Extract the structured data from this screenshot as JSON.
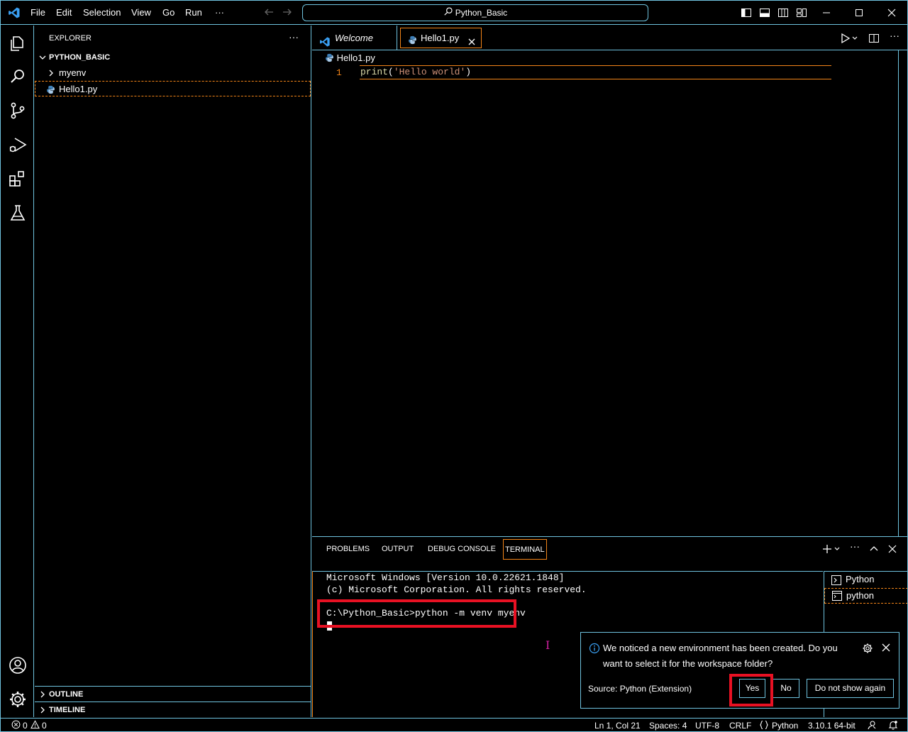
{
  "titlebar": {
    "menus": [
      "File",
      "Edit",
      "Selection",
      "View",
      "Go",
      "Run",
      "···"
    ],
    "search_text": "Python_Basic"
  },
  "sidebar": {
    "title": "EXPLORER",
    "more": "···",
    "folder": "PYTHON_BASIC",
    "items": [
      {
        "label": "myenv"
      },
      {
        "label": "Hello1.py"
      }
    ],
    "outline": "OUTLINE",
    "timeline": "TIMELINE"
  },
  "editor": {
    "tabs": [
      {
        "label": "Welcome"
      },
      {
        "label": "Hello1.py"
      }
    ],
    "breadcrumb": "Hello1.py",
    "line_number": "1",
    "code_fn": "print",
    "code_open": "(",
    "code_string": "'Hello world'",
    "code_close": ")"
  },
  "panel": {
    "tabs": [
      "PROBLEMS",
      "OUTPUT",
      "DEBUG CONSOLE",
      "TERMINAL"
    ],
    "terminal_lines": [
      "Microsoft Windows [Version 10.0.22621.1848]",
      "(c) Microsoft Corporation. All rights reserved."
    ],
    "prompt": "C:\\Python_Basic>python -m venv myenv",
    "terminals": [
      "Python",
      "python"
    ]
  },
  "notification": {
    "message_line1": "We noticed a new environment has been created. Do you",
    "message_line2": "want to select it for the workspace folder?",
    "source": "Source: Python (Extension)",
    "yes": "Yes",
    "no": "No",
    "dont_show": "Do not show again"
  },
  "statusbar": {
    "errors": "0",
    "warnings": "0",
    "position": "Ln 1, Col 21",
    "spaces": "Spaces: 4",
    "encoding": "UTF-8",
    "eol": "CRLF",
    "language": "Python",
    "interpreter": "3.10.1 64-bit"
  },
  "colors": {
    "border": "#6fc3df",
    "active_border": "#f38518",
    "string": "#ce9178",
    "function": "#dcdcaa",
    "highlight_red": "#e81123"
  }
}
